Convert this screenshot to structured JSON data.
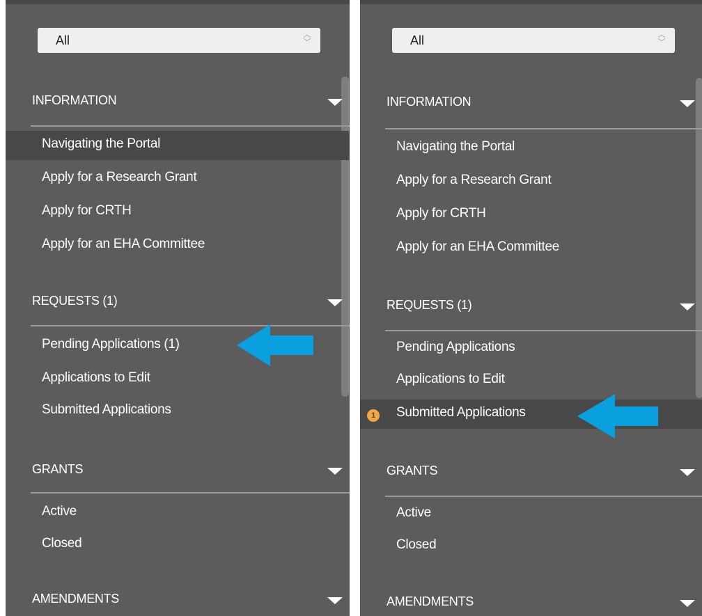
{
  "left_panel": {
    "filter": {
      "value": "All"
    },
    "sections": [
      {
        "title": "INFORMATION",
        "items": [
          "Navigating the Portal",
          "Apply for a Research Grant",
          "Apply for CRTH",
          "Apply for an EHA Committee"
        ]
      },
      {
        "title": "REQUESTS (1)",
        "items": [
          "Pending Applications  (1)",
          "Applications to Edit",
          "Submitted Applications"
        ]
      },
      {
        "title": "GRANTS",
        "items": [
          "Active",
          "Closed"
        ]
      },
      {
        "title": "AMENDMENTS",
        "items": []
      }
    ]
  },
  "right_panel": {
    "filter": {
      "value": "All"
    },
    "sections": [
      {
        "title": "INFORMATION",
        "items": [
          "Navigating the Portal",
          "Apply for a Research Grant",
          "Apply for CRTH",
          "Apply for an EHA Committee"
        ]
      },
      {
        "title": "REQUESTS (1)",
        "items": [
          "Pending Applications",
          "Applications to Edit",
          "Submitted Applications"
        ]
      },
      {
        "title": "GRANTS",
        "items": [
          "Active",
          "Closed"
        ]
      },
      {
        "title": "AMENDMENTS",
        "items": []
      }
    ],
    "badge": "1"
  },
  "icons": {
    "select_arrows": "up-down-chevron-icon",
    "section_toggle": "chevron-down-icon",
    "pointer": "arrow-left-icon"
  },
  "colors": {
    "panel_bg": "#5c5c5c",
    "active_item_bg": "#484848",
    "arrow": "#0aa0e0",
    "badge": "#f0a64a"
  }
}
